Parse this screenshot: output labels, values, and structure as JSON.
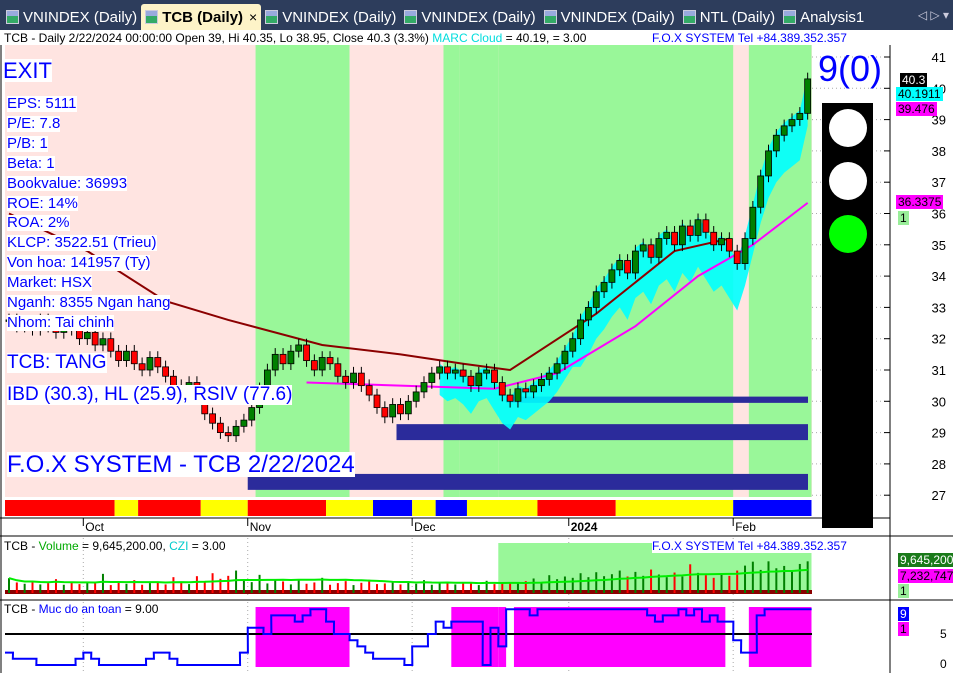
{
  "tabs": [
    {
      "label": "VNINDEX (Daily)"
    },
    {
      "label": "TCB (Daily)",
      "active": true
    },
    {
      "label": "VNINDEX (Daily)"
    },
    {
      "label": "VNINDEX (Daily)"
    },
    {
      "label": "VNINDEX (Daily)"
    },
    {
      "label": "NTL (Daily)"
    },
    {
      "label": "Analysis1"
    }
  ],
  "tab_close": "×",
  "tab_nav": "◁ ▷ ▾",
  "header": {
    "info": "TCB - Daily 2/22/2024 00:00:00 Open 39, Hi 40.35, Lo 38.95, Close 40.3 (3.3%)",
    "cloud_label": "MARC Cloud",
    "cloud_value": "= 40.19,   = 3.00",
    "fox": "F.O.X SYSTEM Tel +84.389.352.357"
  },
  "overlay": {
    "signal": "EXIT",
    "fundamentals": [
      "EPS: 5111",
      "P/E: 7.8",
      "P/B: 1",
      "Beta: 1",
      "Bookvalue: 36993",
      "ROE: 14%",
      "ROA: 2%",
      "KLCP: 3522.51 (Trieu)",
      "Von hoa: 141957 (Ty)",
      "Market: HSX",
      "Nganh: 8355 Ngan hang",
      "Nhom: Tai chinh"
    ],
    "trend": "TCB: TANG",
    "ratings": "IBD (30.3), HL (25.9), RSIV (77.6)",
    "title": "F.O.X SYSTEM - TCB 2/22/2024",
    "score": "9(0)"
  },
  "traffic_light": {
    "lamps": [
      "#ffffff",
      "#ffffff",
      "#00ff00"
    ]
  },
  "price_tags": [
    {
      "text": "40.3",
      "bg": "#000000",
      "fg": "#ffffff",
      "value": 40.3
    },
    {
      "text": "40.1911",
      "bg": "#00ffff",
      "fg": "#000000",
      "value": 40.1911
    },
    {
      "text": "39.476",
      "bg": "#ff00ff",
      "fg": "#000000",
      "value": 39.476
    },
    {
      "text": "36.3375",
      "bg": "#ff00ff",
      "fg": "#000000",
      "value": 36.3375
    },
    {
      "text": "1",
      "bg": "#99ee99",
      "fg": "#000000",
      "value": 35.8
    }
  ],
  "volume_panel": {
    "label_prefix": "TCB - ",
    "label_name": "Volume",
    "label_value": " = 9,645,200.00, ",
    "czi": "CZI",
    "czi_value": " = 3.00",
    "fox": "F.O.X SYSTEM Tel +84.389.352.357",
    "tags": [
      "9,645,200",
      "7,232,747",
      "1"
    ]
  },
  "safety_panel": {
    "label_prefix": "TCB - ",
    "label_name": "Muc do an toan",
    "label_value": " = 9.00",
    "tags": [
      "9",
      "1"
    ],
    "ticks": [
      "5",
      "0"
    ]
  },
  "colors": {
    "up": "#008000",
    "down": "#ff0000",
    "green_zone": "#99f799",
    "pink_zone": "#ffe4e1",
    "cloud": "#00ffff",
    "trail": "#ff00ff",
    "support": "#2b2b9b",
    "safety_fill": "#ff00ff",
    "safety_line": "#0000ff"
  },
  "chart_data": {
    "type": "candlestick",
    "x_ticks": [
      {
        "label": "Oct",
        "bar": 10
      },
      {
        "label": "Nov",
        "bar": 31
      },
      {
        "label": "Dec",
        "bar": 52
      },
      {
        "label": "2024",
        "bar": 72
      },
      {
        "label": "Feb",
        "bar": 93
      }
    ],
    "y_ticks": [
      27,
      28,
      29,
      30,
      31,
      32,
      33,
      34,
      35,
      36,
      37,
      38,
      39,
      40,
      41
    ],
    "ylim": [
      26.5,
      41.4
    ],
    "close": [
      32.6,
      32.4,
      32.5,
      32.3,
      32.6,
      32.4,
      32.2,
      32.5,
      32.3,
      32.0,
      32.2,
      31.8,
      32.0,
      31.6,
      31.3,
      31.6,
      31.2,
      31.0,
      31.4,
      31.1,
      30.8,
      30.5,
      30.2,
      30.6,
      30.1,
      29.6,
      29.3,
      29.0,
      28.9,
      29.2,
      29.4,
      29.8,
      30.4,
      31.0,
      31.5,
      31.2,
      31.6,
      31.8,
      31.3,
      31.0,
      31.4,
      31.2,
      30.8,
      30.6,
      30.9,
      30.5,
      30.2,
      29.8,
      29.5,
      29.9,
      29.6,
      30.0,
      30.3,
      30.6,
      30.9,
      31.1,
      30.9,
      31.0,
      30.8,
      30.5,
      30.9,
      31.0,
      30.6,
      30.2,
      30.0,
      30.4,
      30.3,
      30.5,
      30.7,
      30.9,
      31.2,
      31.6,
      32.0,
      32.6,
      33.0,
      33.5,
      33.8,
      34.2,
      34.5,
      34.1,
      34.8,
      35.0,
      34.6,
      35.2,
      35.4,
      35.0,
      35.6,
      35.3,
      35.8,
      35.4,
      35.0,
      35.2,
      34.8,
      34.4,
      35.2,
      36.2,
      37.2,
      38.0,
      38.5,
      38.8,
      39.0,
      39.2,
      40.3
    ],
    "green_zones": [
      [
        32,
        43
      ],
      [
        56,
        57
      ],
      [
        58,
        62
      ],
      [
        63,
        92
      ],
      [
        95,
        102
      ]
    ],
    "trail_line": [
      [
        38,
        30.6
      ],
      [
        50,
        30.5
      ],
      [
        62,
        30.4
      ],
      [
        70,
        30.9
      ],
      [
        80,
        32.4
      ],
      [
        88,
        34.0
      ],
      [
        95,
        35.0
      ],
      [
        102,
        36.34
      ]
    ],
    "resistance_line": [
      [
        0,
        36.0
      ],
      [
        10,
        34.8
      ],
      [
        20,
        33.2
      ],
      [
        28,
        32.6
      ],
      [
        40,
        31.8
      ],
      [
        50,
        31.5
      ],
      [
        58,
        31.2
      ],
      [
        64,
        31.0
      ],
      [
        75,
        32.8
      ],
      [
        85,
        34.8
      ],
      [
        92,
        35.2
      ]
    ],
    "support_zones": [
      [
        64,
        29.95,
        30.15
      ],
      [
        50,
        28.76,
        29.27
      ],
      [
        31,
        27.17,
        27.68
      ]
    ],
    "signal_strip": [
      [
        "#ff0000",
        0,
        13
      ],
      [
        "#ffff00",
        14,
        16
      ],
      [
        "#ff0000",
        17,
        24
      ],
      [
        "#ffff00",
        25,
        30
      ],
      [
        "#ff0000",
        31,
        40
      ],
      [
        "#ffff00",
        41,
        46
      ],
      [
        "#0000ff",
        47,
        51
      ],
      [
        "#ffff00",
        52,
        54
      ],
      [
        "#0000ff",
        55,
        58
      ],
      [
        "#ffff00",
        59,
        67
      ],
      [
        "#ff0000",
        68,
        77
      ],
      [
        "#ffff00",
        78,
        92
      ],
      [
        "#0000ff",
        93,
        102
      ]
    ],
    "volume": [
      4.5,
      3.2,
      2.8,
      3.5,
      2.6,
      3.0,
      4.2,
      2.5,
      3.1,
      2.7,
      3.3,
      2.9,
      5.8,
      2.4,
      3.6,
      2.8,
      3.9,
      2.5,
      3.0,
      3.4,
      2.6,
      4.8,
      3.2,
      2.7,
      5.1,
      3.6,
      6.0,
      4.3,
      5.2,
      6.8,
      4.0,
      3.3,
      5.5,
      2.9,
      4.1,
      3.5,
      2.6,
      3.8,
      2.8,
      3.2,
      4.6,
      2.5,
      3.0,
      3.6,
      2.4,
      3.1,
      4.0,
      2.7,
      2.9,
      3.3,
      2.6,
      3.5,
      2.8,
      3.9,
      2.5,
      3.0,
      3.4,
      2.6,
      2.9,
      3.1,
      2.4,
      3.7,
      2.7,
      3.3,
      2.9,
      3.0,
      3.6,
      4.4,
      3.1,
      5.4,
      4.2,
      5.0,
      4.6,
      6.0,
      4.8,
      6.3,
      5.1,
      5.7,
      6.8,
      5.0,
      6.4,
      5.2,
      7.1,
      5.6,
      4.8,
      6.2,
      5.0,
      8.7,
      6.1,
      5.4,
      4.6,
      6.0,
      5.2,
      6.8,
      8.3,
      9.5,
      7.0,
      9.6,
      7.5,
      8.2,
      6.9,
      8.8,
      9.6
    ],
    "volume_ma_end": 7.23,
    "safety": [
      2,
      1,
      1,
      1,
      0,
      0,
      0,
      0,
      0,
      1,
      2,
      1,
      0,
      0,
      0,
      0,
      0,
      0,
      1,
      2,
      2,
      1,
      0,
      0,
      0,
      0,
      0,
      0,
      0,
      0,
      2,
      6,
      6,
      5,
      8,
      8,
      8,
      7,
      8,
      9,
      9,
      7,
      5,
      5,
      4,
      3,
      2,
      1,
      1,
      1,
      1,
      0,
      3,
      3,
      5,
      7,
      6,
      7,
      7,
      7,
      7,
      0,
      6,
      3,
      9,
      9,
      9,
      8,
      9,
      9,
      9,
      9,
      9,
      9,
      9,
      9,
      9,
      9,
      9,
      9,
      9,
      9,
      8,
      7,
      8,
      8,
      9,
      8,
      9,
      7,
      8,
      7,
      7,
      4,
      2,
      2,
      8,
      9,
      9,
      9,
      9,
      9,
      9
    ],
    "safety_zones": [
      [
        32,
        43
      ],
      [
        57,
        62
      ],
      [
        63,
        63
      ],
      [
        65,
        91
      ],
      [
        95,
        102
      ]
    ],
    "safety_threshold": 5
  }
}
